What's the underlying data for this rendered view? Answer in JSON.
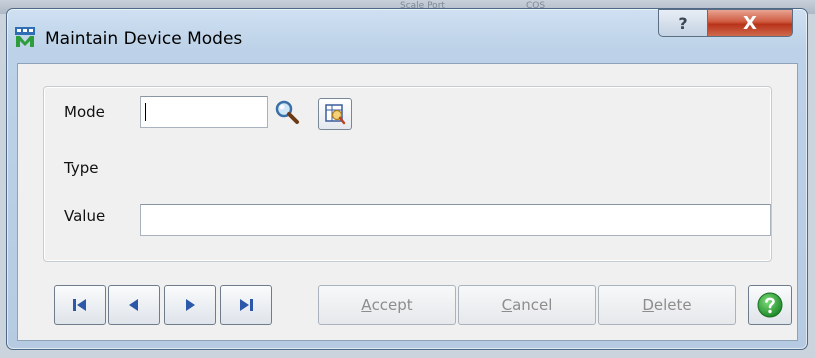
{
  "background": {
    "snippets": [
      "Scale Port",
      "COS"
    ]
  },
  "window": {
    "title": "Maintain Device Modes",
    "help_glyph": "?",
    "close_glyph": "X"
  },
  "form": {
    "mode_label": "Mode",
    "mode_value": "",
    "type_label": "Type",
    "type_value": "",
    "value_label": "Value",
    "value_value": "",
    "lookup_icon": "magnifier-icon",
    "inquiry_icon": "inquiry-grid-icon"
  },
  "navigation": {
    "buttons": [
      "first-record",
      "previous-record",
      "next-record",
      "last-record"
    ]
  },
  "actions": {
    "accept": {
      "hotkey": "A",
      "rest": "ccept"
    },
    "cancel": {
      "hotkey": "C",
      "rest": "ancel"
    },
    "delete": {
      "hotkey": "D",
      "rest": "elete"
    }
  },
  "colors": {
    "title_gradient_top": "#cfe0f1",
    "close_red": "#c94a2e",
    "help_green": "#2fa53a",
    "nav_arrow_blue": "#2b58a8",
    "disabled_text": "#8d8d8d"
  }
}
